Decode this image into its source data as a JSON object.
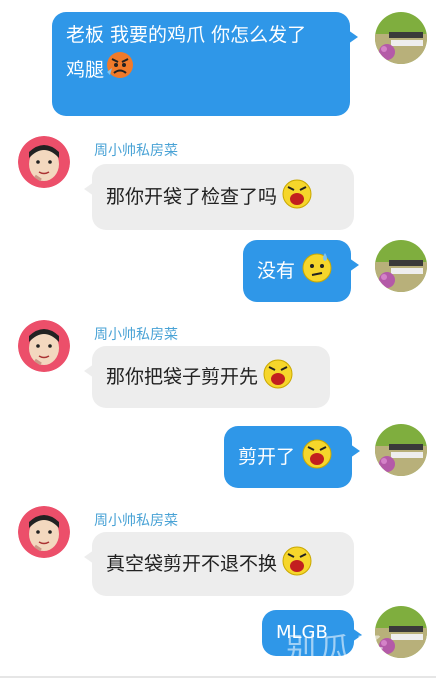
{
  "contact": {
    "name": "周小帅私房菜"
  },
  "messages": [
    {
      "side": "me",
      "lines": [
        "老板 我要的鸡爪 你怎么发了",
        "鸡腿"
      ]
    },
    {
      "side": "peer",
      "text": "那你开袋了检查了吗"
    },
    {
      "side": "me",
      "text": "没有"
    },
    {
      "side": "peer",
      "text": "那你把袋子剪开先"
    },
    {
      "side": "me",
      "text": "剪开了"
    },
    {
      "side": "peer",
      "text": "真空袋剪开不退不换"
    },
    {
      "side": "me",
      "text": "MLGB"
    }
  ],
  "watermark": "别瓜子",
  "colors": {
    "me_bubble": "#2f97e8",
    "peer_bubble": "#ededed",
    "name": "#4aa3d6"
  }
}
